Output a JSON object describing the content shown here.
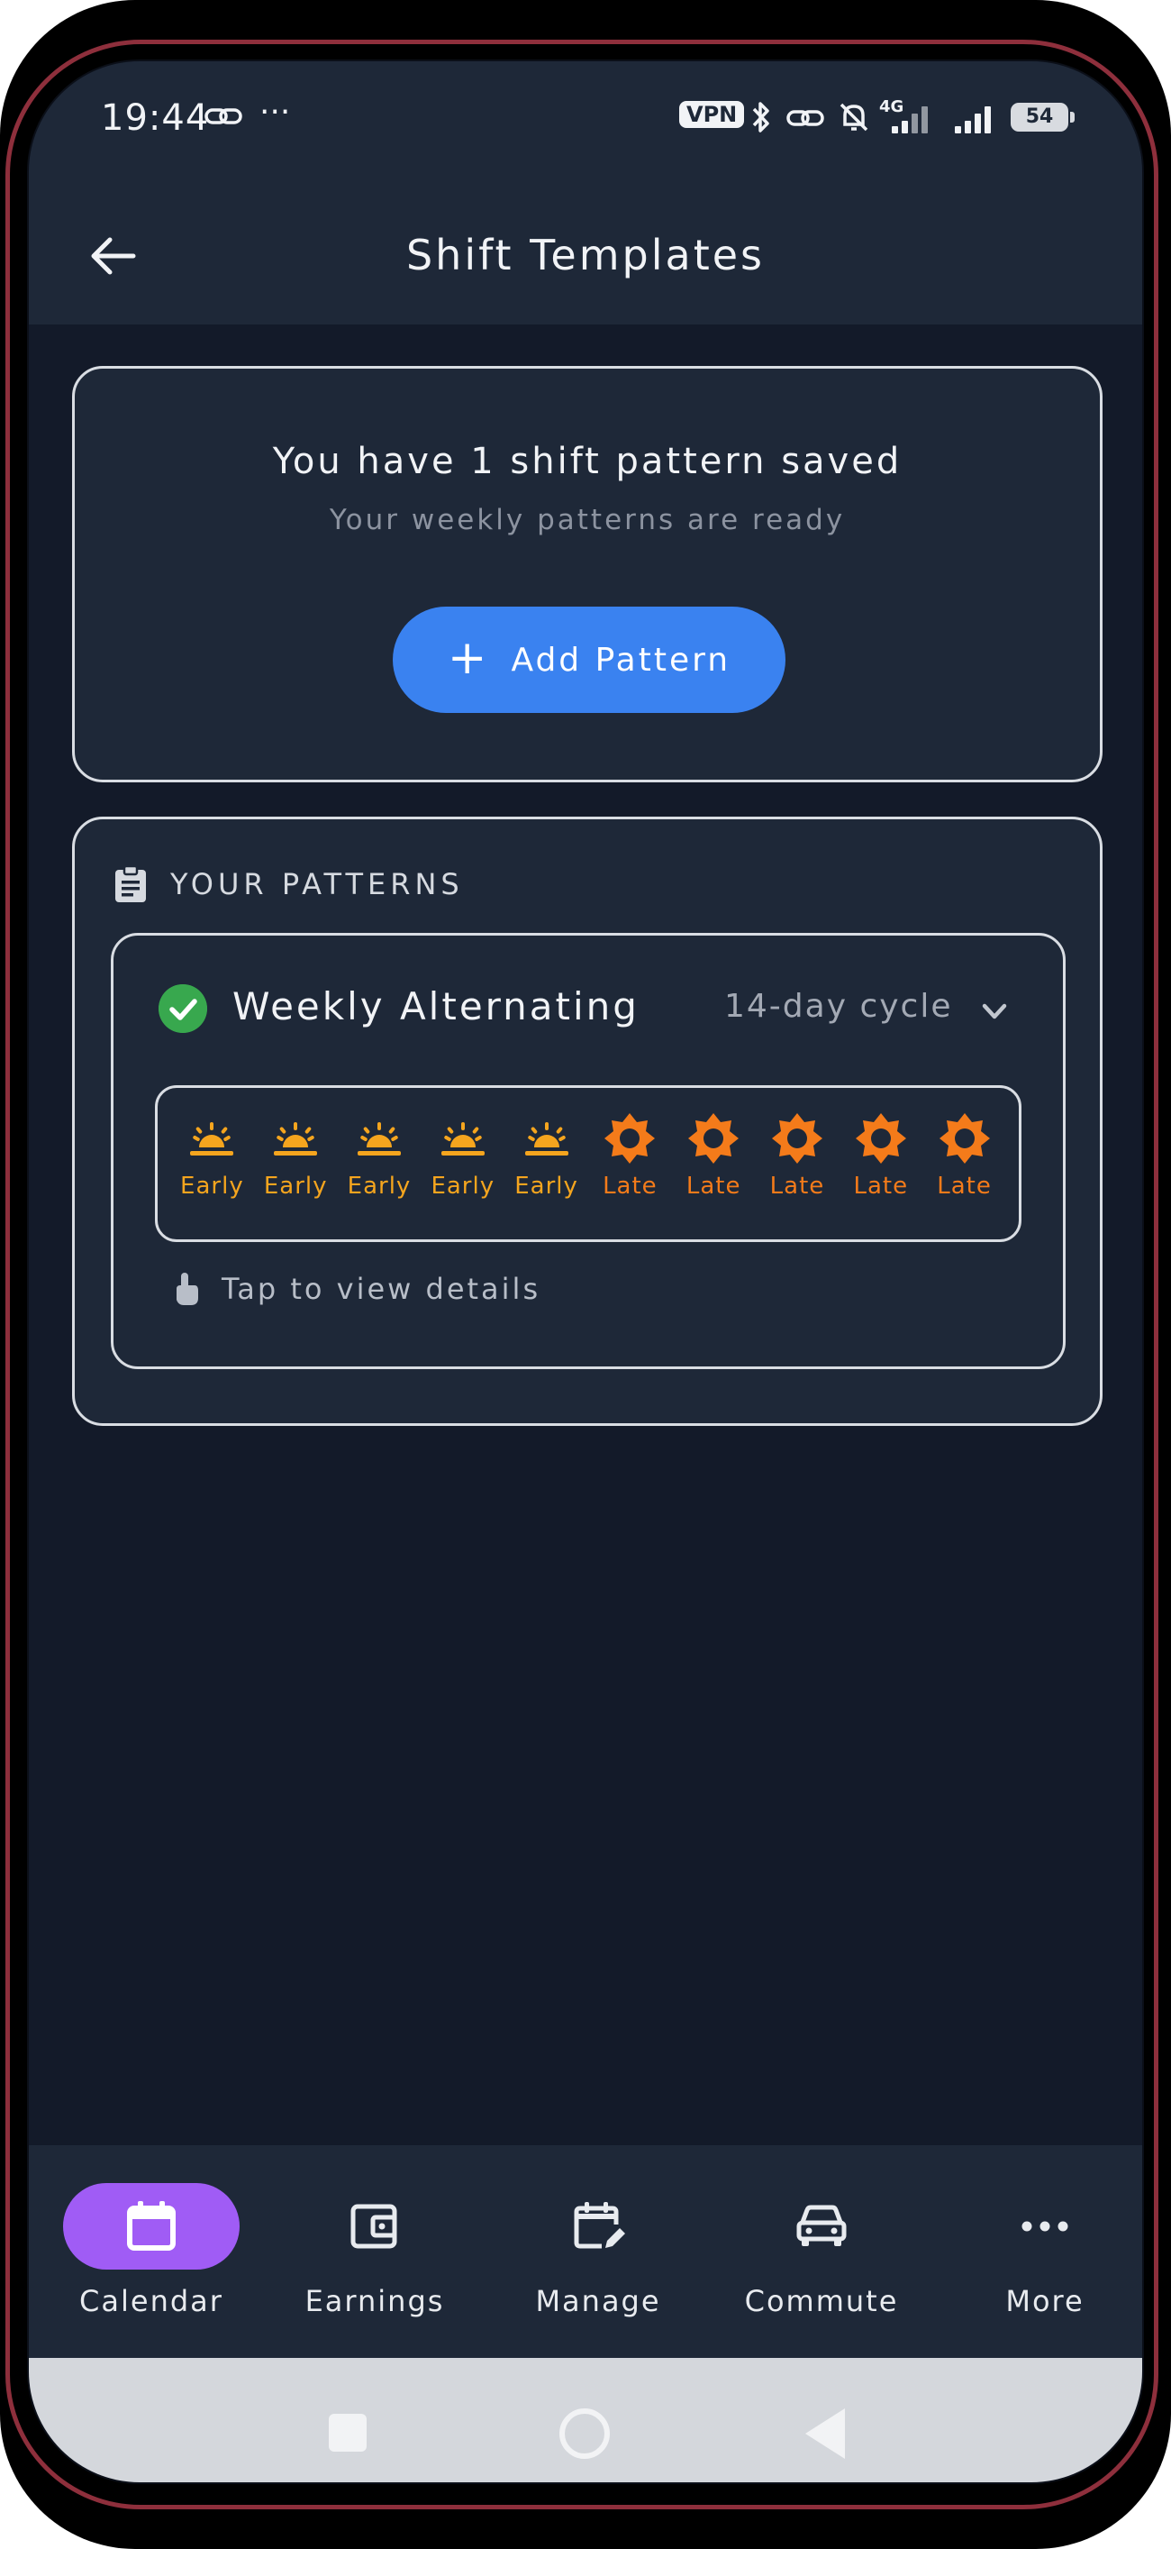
{
  "status_bar": {
    "time": "19:44",
    "more_dots": "···",
    "vpn": "VPN",
    "network": "4G",
    "battery": "54"
  },
  "app_bar": {
    "title": "Shift Templates",
    "back_icon": "arrow-left-icon"
  },
  "summary_card": {
    "title": "You have 1 shift pattern saved",
    "subtitle": "Your weekly patterns are ready",
    "add_button": {
      "icon": "+",
      "label": "Add Pattern"
    }
  },
  "patterns_section": {
    "header": "YOUR PATTERNS",
    "header_icon": "clipboard-icon",
    "patterns": [
      {
        "name": "Weekly Alternating",
        "cycle": "14-day cycle",
        "status_icon": "check-circle-icon",
        "days": [
          {
            "type": "early",
            "label": "Early",
            "icon": "sunrise-icon"
          },
          {
            "type": "early",
            "label": "Early",
            "icon": "sunrise-icon"
          },
          {
            "type": "early",
            "label": "Early",
            "icon": "sunrise-icon"
          },
          {
            "type": "early",
            "label": "Early",
            "icon": "sunrise-icon"
          },
          {
            "type": "early",
            "label": "Early",
            "icon": "sunrise-icon"
          },
          {
            "type": "late",
            "label": "Late",
            "icon": "sun-icon"
          },
          {
            "type": "late",
            "label": "Late",
            "icon": "sun-icon"
          },
          {
            "type": "late",
            "label": "Late",
            "icon": "sun-icon"
          },
          {
            "type": "late",
            "label": "Late",
            "icon": "sun-icon"
          },
          {
            "type": "late",
            "label": "Late",
            "icon": "sun-icon"
          }
        ],
        "hint": "Tap to view details"
      }
    ]
  },
  "bottom_nav": {
    "items": [
      {
        "label": "Calendar",
        "icon": "calendar-icon",
        "active": true
      },
      {
        "label": "Earnings",
        "icon": "wallet-icon",
        "active": false
      },
      {
        "label": "Manage",
        "icon": "calendar-edit-icon",
        "active": false
      },
      {
        "label": "Commute",
        "icon": "car-icon",
        "active": false
      },
      {
        "label": "More",
        "icon": "more-horizontal-icon",
        "active": false
      }
    ]
  },
  "colors": {
    "background": "#131a29",
    "surface": "#1e2838",
    "primary": "#3a82f0",
    "active_nav": "#a05cf5",
    "early": "#f5a51e",
    "late": "#f47b1a",
    "success": "#38a84e"
  }
}
